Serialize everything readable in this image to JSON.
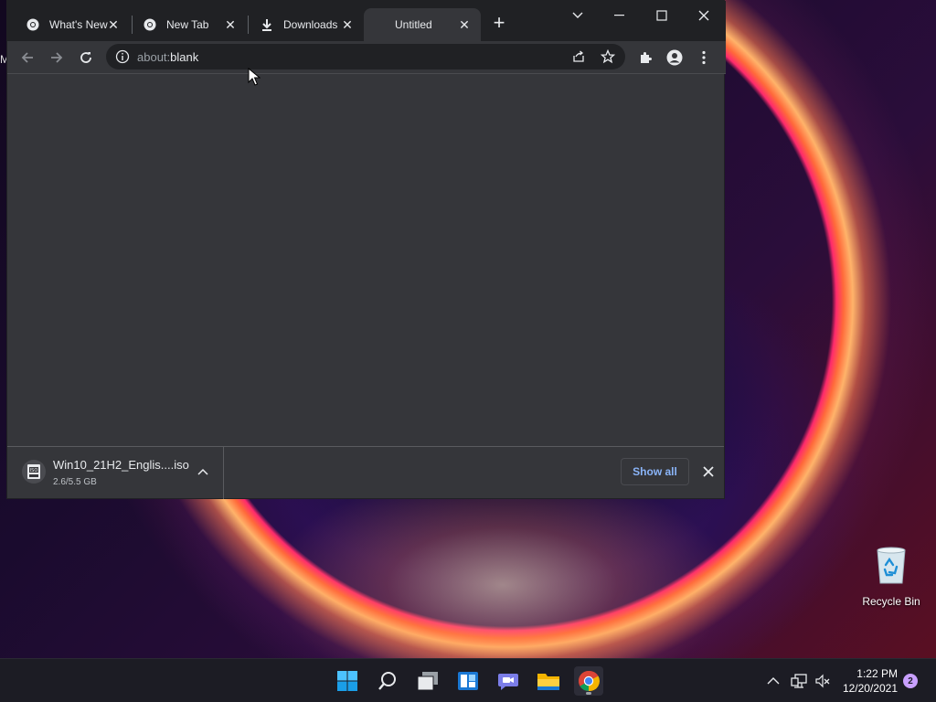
{
  "desktop": {
    "left_edge_text": "M",
    "recycle_bin_label": "Recycle Bin"
  },
  "browser": {
    "tabs": [
      {
        "label": "What's New",
        "icon": "chrome-icon"
      },
      {
        "label": "New Tab",
        "icon": "chrome-icon"
      },
      {
        "label": "Downloads",
        "icon": "download-icon"
      },
      {
        "label": "Untitled",
        "icon": "none",
        "active": true
      }
    ],
    "address": {
      "scheme": "about:",
      "path": "blank"
    },
    "download_shelf": {
      "file_name": "Win10_21H2_Englis....iso",
      "progress_text": "2.6/5.5 GB",
      "progress_fraction": 0.47,
      "show_all_label": "Show all"
    },
    "colors": {
      "tabstrip": "#202124",
      "toolbar": "#35363a",
      "accent_link": "#8ab4f8"
    }
  },
  "taskbar": {
    "apps": [
      "start-icon",
      "search-icon",
      "task-view-icon",
      "widgets-icon",
      "chat-icon",
      "file-explorer-icon",
      "chrome-icon"
    ],
    "clock_time": "1:22 PM",
    "clock_date": "12/20/2021",
    "notification_count": "2"
  }
}
